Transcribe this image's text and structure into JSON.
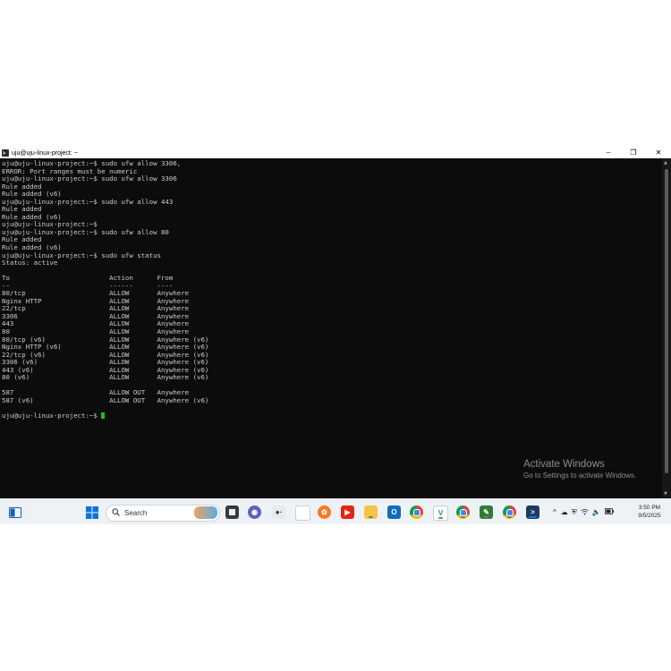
{
  "window": {
    "title": "uju@uju-linux-project: ~",
    "minimize_glyph": "–",
    "maximize_glyph": "❐",
    "close_glyph": "✕"
  },
  "terminal": {
    "lines": [
      "uju@uju-linux-project:~$ sudo ufw allow 3306,",
      "ERROR: Port ranges must be numeric",
      "uju@uju-linux-project:~$ sudo ufw allow 3306",
      "Rule added",
      "Rule added (v6)",
      "uju@uju-linux-project:~$ sudo ufw allow 443",
      "Rule added",
      "Rule added (v6)",
      "uju@uju-linux-project:~$",
      "uju@uju-linux-project:~$ sudo ufw allow 80",
      "Rule added",
      "Rule added (v6)",
      "uju@uju-linux-project:~$ sudo ufw status",
      "Status: active",
      "",
      "To                         Action      From",
      "--                         ------      ----",
      "80/tcp                     ALLOW       Anywhere",
      "Nginx HTTP                 ALLOW       Anywhere",
      "22/tcp                     ALLOW       Anywhere",
      "3306                       ALLOW       Anywhere",
      "443                        ALLOW       Anywhere",
      "80                         ALLOW       Anywhere",
      "80/tcp (v6)                ALLOW       Anywhere (v6)",
      "Nginx HTTP (v6)            ALLOW       Anywhere (v6)",
      "22/tcp (v6)                ALLOW       Anywhere (v6)",
      "3306 (v6)                  ALLOW       Anywhere (v6)",
      "443 (v6)                   ALLOW       Anywhere (v6)",
      "80 (v6)                    ALLOW       Anywhere (v6)",
      "",
      "587                        ALLOW OUT   Anywhere",
      "587 (v6)                   ALLOW OUT   Anywhere (v6)",
      ""
    ],
    "prompt": "uju@uju-linux-project:~$ ",
    "cursor_color": "#16c60c"
  },
  "watermark": {
    "title": "Activate Windows",
    "subtitle": "Go to Settings to activate Windows."
  },
  "taskbar": {
    "search_placeholder": "Search",
    "pinned_icons": [
      "task-view-icon",
      "windows-start-icon",
      "widgets-icon",
      "file-icon",
      "chat-icon",
      "dots-icon",
      "document-icon",
      "app-orange-icon",
      "youtube-icon",
      "file-explorer-icon",
      "outlook-icon",
      "chrome-icon",
      "vscode-icon",
      "chrome-profile-icon",
      "notepad-icon",
      "chrome-alt-icon",
      "terminal-icon"
    ],
    "tray": {
      "chevron": "^",
      "clock_time": "3:50 PM",
      "clock_date": "9/5/2025"
    }
  },
  "colors": {
    "terminal_bg": "#0c0c0c",
    "terminal_fg": "#cccccc",
    "taskbar_bg": "#eef1f6"
  }
}
